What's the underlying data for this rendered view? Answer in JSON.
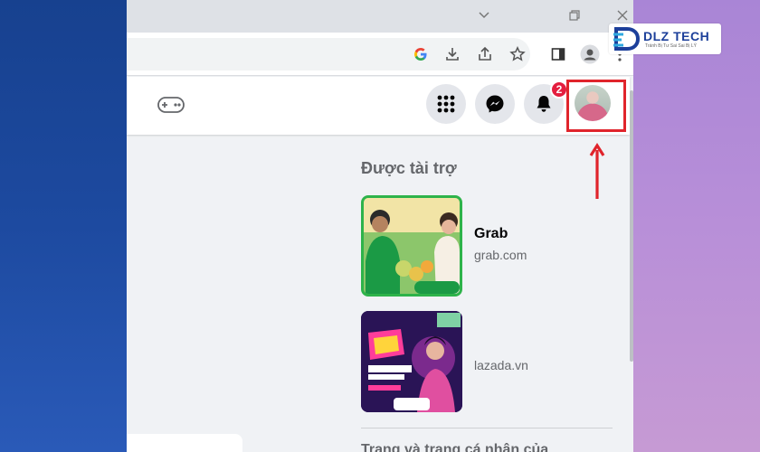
{
  "sponsored": {
    "title": "Được tài trợ",
    "ads": [
      {
        "name": "Grab",
        "url": "grab.com"
      },
      {
        "name": "",
        "url": "lazada.vn"
      }
    ]
  },
  "header": {
    "notification_count": "2"
  },
  "bottom": {
    "partial_heading": "Trang và trang cá nhân của"
  },
  "logo": {
    "text": "DLZ TECH",
    "tagline": "Tránh Bị Tư Sai Sai Bị LÝ"
  },
  "colors": {
    "highlight": "#e0242b",
    "badge": "#e41e3f",
    "facebook_bg": "#f0f2f5"
  },
  "icons": [
    "chevron-down-icon",
    "restore-icon",
    "close-icon",
    "google-icon",
    "download-icon",
    "share-icon",
    "star-icon",
    "sidebar-panel-icon",
    "profile-icon",
    "more-icon",
    "gaming-icon",
    "menu-grid-icon",
    "messenger-icon",
    "bell-icon",
    "arrow-up-icon"
  ]
}
